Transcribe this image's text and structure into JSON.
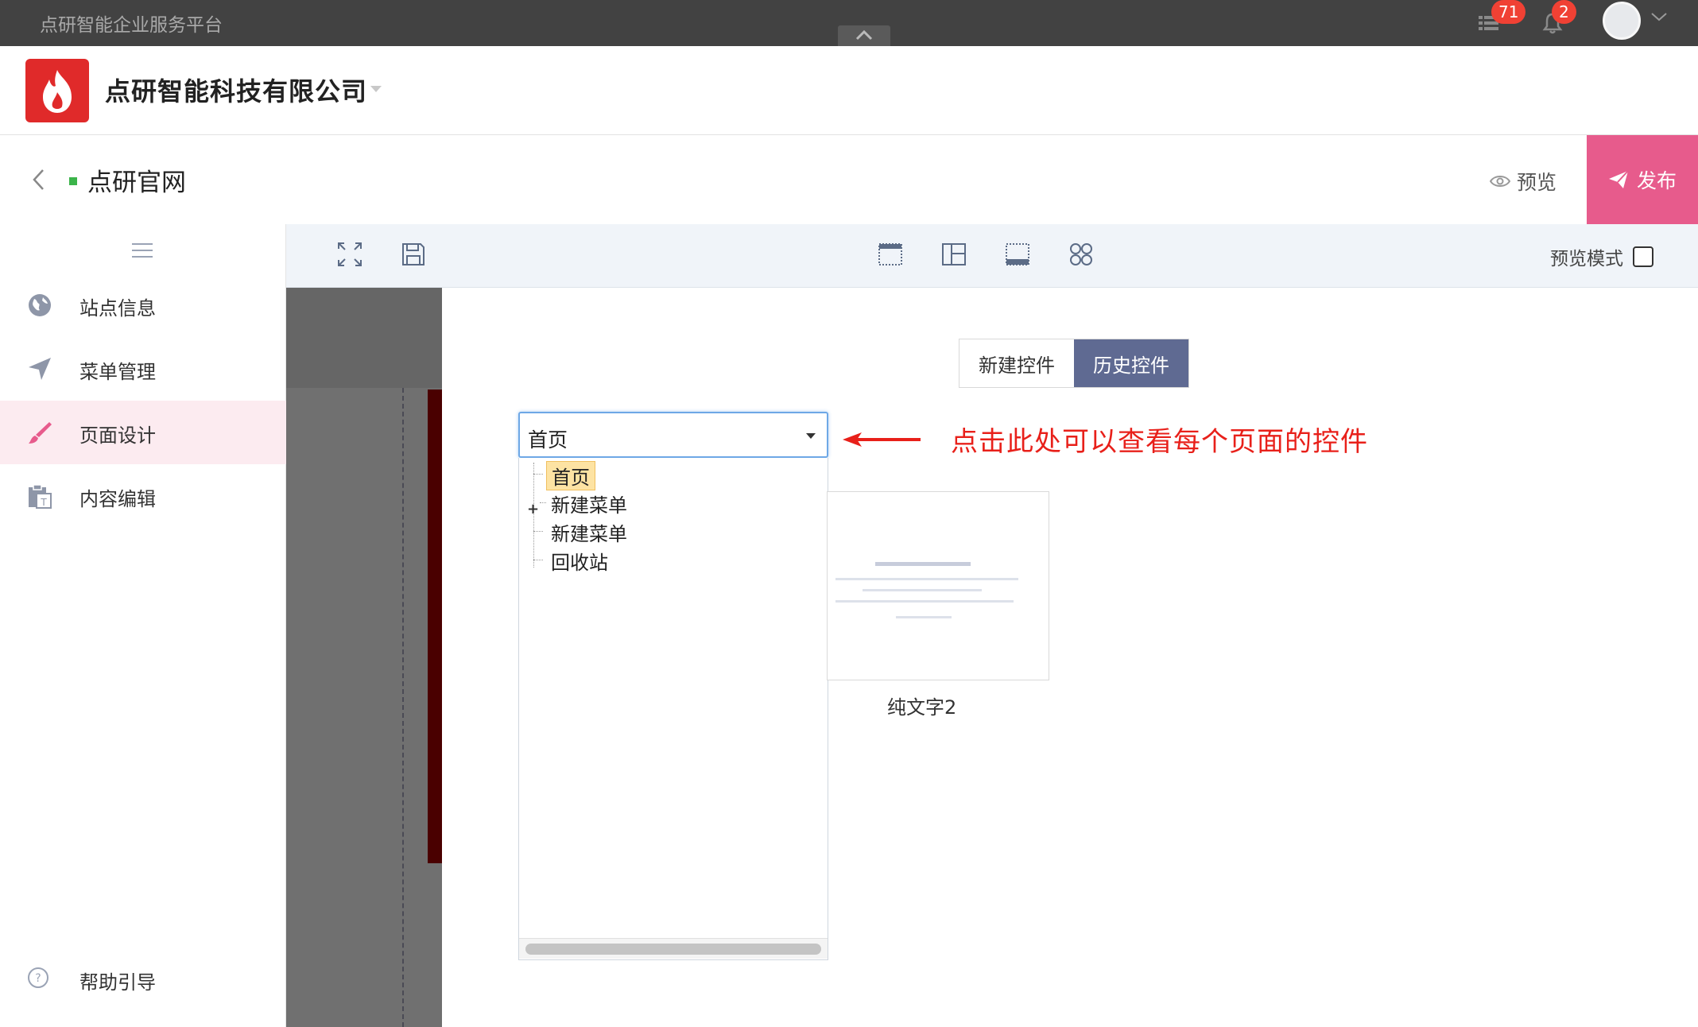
{
  "topbar": {
    "platform_name": "点研智能企业服务平台",
    "tasks_badge": "71",
    "notifications_badge": "2"
  },
  "company": {
    "name": "点研智能科技有限公司"
  },
  "site": {
    "title": "点研官网",
    "preview_label": "预览",
    "publish_label": "发布"
  },
  "sidebar": {
    "items": [
      {
        "label": "站点信息",
        "icon": "globe-icon"
      },
      {
        "label": "菜单管理",
        "icon": "send-icon"
      },
      {
        "label": "页面设计",
        "icon": "brush-icon",
        "active": true
      },
      {
        "label": "内容编辑",
        "icon": "clipboard-icon"
      }
    ],
    "help_label": "帮助引导"
  },
  "toolbar": {
    "preview_mode_label": "预览模式"
  },
  "modal": {
    "tabs": [
      {
        "label": "新建控件",
        "active": false
      },
      {
        "label": "历史控件",
        "active": true
      }
    ],
    "page_select": {
      "value": "首页",
      "options": [
        "首页",
        "新建菜单",
        "新建菜单",
        "回收站"
      ]
    },
    "annotation": "点击此处可以查看每个页面的控件",
    "widget_card": {
      "caption": "纯文字2"
    }
  },
  "colors": {
    "topbar_bg": "#424242",
    "publish_bg": "#e75b8c",
    "active_tab_bg": "#5f6a92",
    "annotation_red": "#e8201a",
    "sidebar_active_bg": "#fcebf0",
    "badge_red": "#f04134"
  }
}
